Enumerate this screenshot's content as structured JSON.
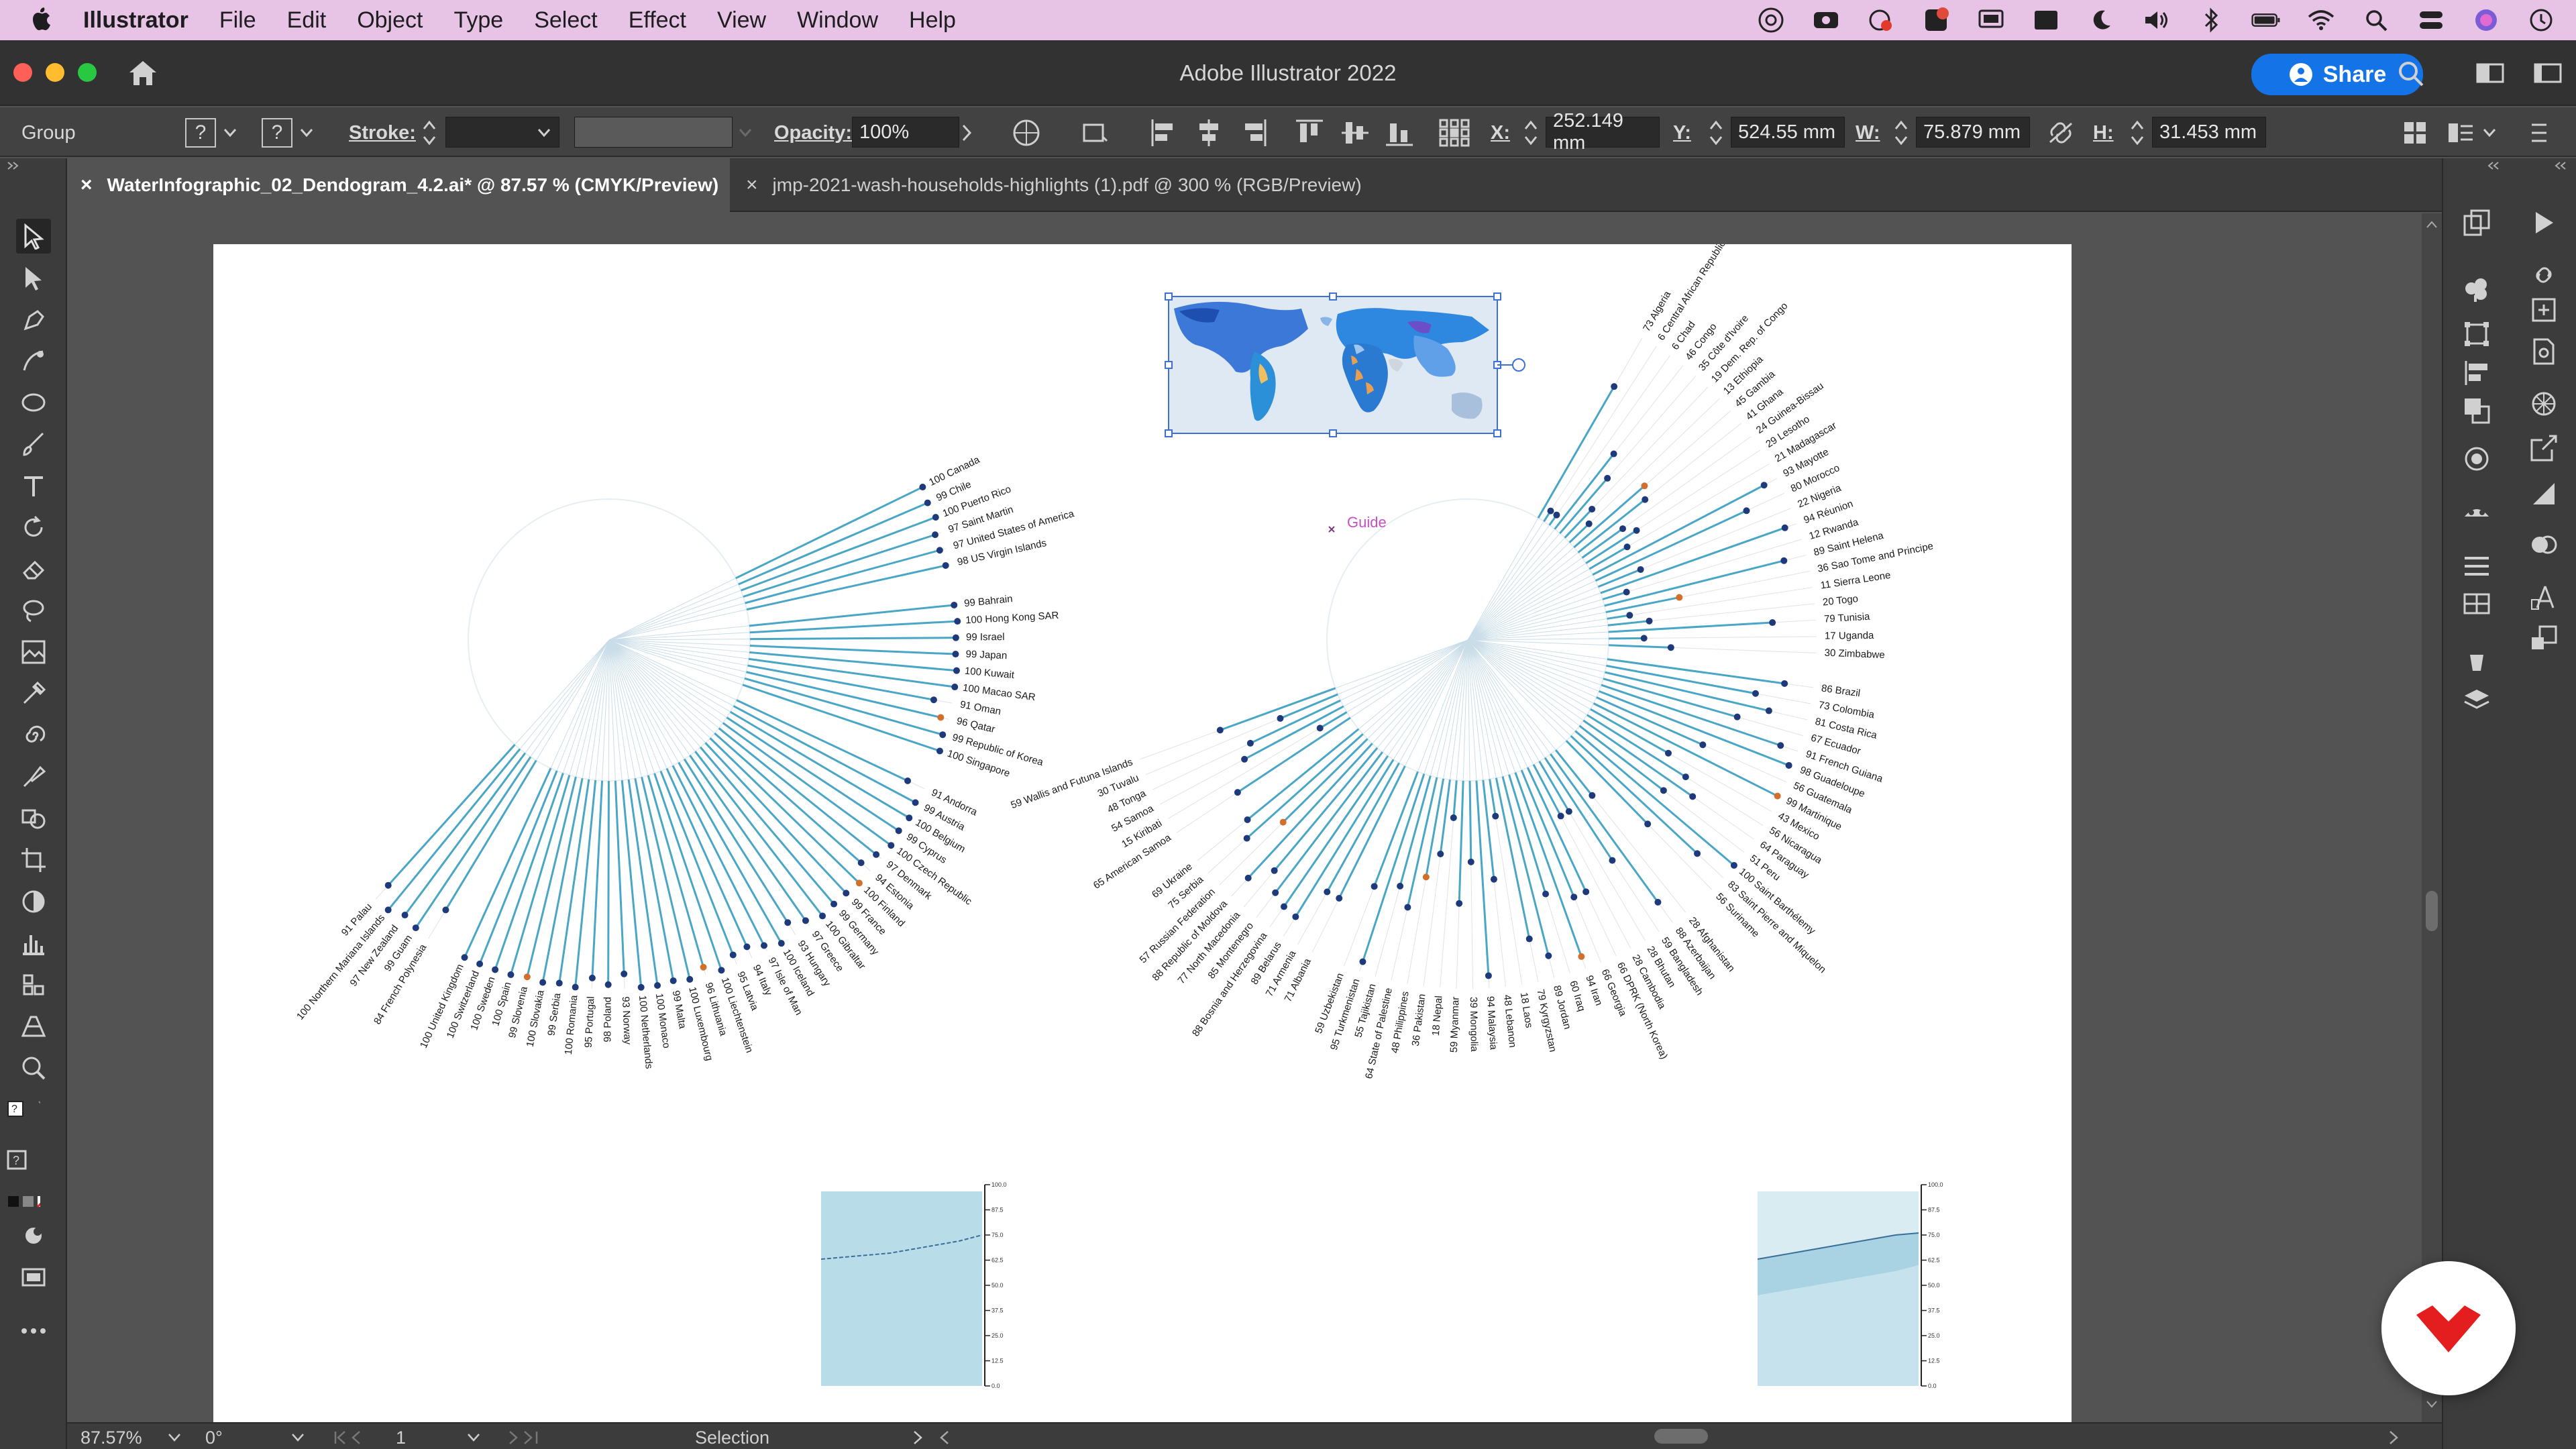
{
  "menubar": {
    "items": [
      "Illustrator",
      "File",
      "Edit",
      "Object",
      "Type",
      "Select",
      "Effect",
      "View",
      "Window",
      "Help"
    ]
  },
  "titlebar": {
    "title": "Adobe Illustrator 2022",
    "share_label": "Share"
  },
  "controlbar": {
    "selection_type": "Group",
    "stroke_label": "Stroke:",
    "opacity_label": "Opacity:",
    "opacity_value": "100%",
    "x_label": "X:",
    "x_value": "252.149 mm",
    "y_label": "Y:",
    "y_value": "524.55 mm",
    "w_label": "W:",
    "w_value": "75.879 mm",
    "h_label": "H:",
    "h_value": "31.453 mm"
  },
  "tabs": [
    {
      "label": "WaterInfographic_02_Dendogram_4.2.ai* @ 87.57 % (CMYK/Preview)",
      "active": true
    },
    {
      "label": "jmp-2021-wash-households-highlights (1).pdf @ 300 % (RGB/Preview)",
      "active": false
    }
  ],
  "canvas": {
    "guide_label": "Guide"
  },
  "statusbar": {
    "zoom": "87.57%",
    "rotation": "0°",
    "artboard": "1",
    "tool": "Selection"
  },
  "colors": {
    "menubar_bg": "#e7c3e6",
    "accent_blue": "#1473e6",
    "line_teal": "#4aa6c6",
    "dot_navy": "#1f3a7a",
    "dot_orange": "#d2702b",
    "area_light": "#b9dde8"
  },
  "left_dendrogram": {
    "group_a": [
      "100 Canada",
      "99 Chile",
      "100 Puerto Rico",
      "97 Saint Martin",
      "97 United States of America",
      "98 US Virgin Islands"
    ],
    "group_b": [
      "99 Bahrain",
      "100 Hong Kong SAR",
      "99 Israel",
      "99 Japan",
      "100 Kuwait",
      "100 Macao SAR",
      "91 Oman",
      "96 Qatar",
      "99 Republic of Korea",
      "100 Singapore"
    ],
    "group_c": [
      "91 Andorra",
      "99 Austria",
      "100 Belgium",
      "99 Cyprus",
      "100 Czech Republic",
      "97 Denmark",
      "94 Estonia",
      "100 Finland",
      "99 France",
      "99 Germany",
      "100 Gibraltar",
      "97 Greece",
      "93 Hungary",
      "100 Iceland",
      "97 Isle of Man",
      "94 Italy",
      "95 Latvia",
      "100 Liechtenstein",
      "96 Lithuania",
      "100 Luxembourg",
      "99 Malta",
      "100 Monaco",
      "100 Netherlands",
      "93 Norway",
      "98 Poland",
      "95 Portugal",
      "100 Romania",
      "99 Serbia",
      "100 Slovakia",
      "99 Slovenia",
      "100 Spain",
      "100 Sweden",
      "100 Switzerland",
      "100 United Kingdom"
    ],
    "group_d": [
      "84 French Polynesia",
      "99 Guam",
      "97 New Zealand",
      "100 Northern Mariana Islands",
      "91 Palau"
    ]
  },
  "right_dendrogram": {
    "group_a": [
      "73 Algeria",
      "6 Central African Republic",
      "6 Chad",
      "46 Congo",
      "35 Côte d'Ivoire",
      "19 Dem. Rep. of Congo",
      "13 Ethiopia",
      "45 Gambia",
      "41 Ghana",
      "24 Guinea-Bissau",
      "29 Lesotho",
      "21 Madagascar",
      "93 Mayotte",
      "80 Morocco",
      "22 Nigeria",
      "94 Réunion",
      "12 Rwanda",
      "89 Saint Helena",
      "36 Sao Tome and Principe",
      "11 Sierra Leone",
      "20 Togo",
      "79 Tunisia",
      "17 Uganda",
      "30 Zimbabwe"
    ],
    "group_b": [
      "86 Brazil",
      "73 Colombia",
      "81 Costa Rica",
      "67 Ecuador",
      "91 French Guiana",
      "98 Guadeloupe",
      "56 Guatemala",
      "99 Martinique",
      "43 Mexico",
      "56 Nicaragua",
      "64 Paraguay",
      "51 Peru",
      "100 Saint Barthélemy",
      "83 Saint Pierre and Miquelon",
      "56 Suriname"
    ],
    "group_c": [
      "28 Afghanistan",
      "88 Azerbaijan",
      "59 Bangladesh",
      "28 Bhutan",
      "28 Cambodia",
      "66 DPRK (North Korea)",
      "66 Georgia",
      "94 Iran",
      "60 Iraq",
      "89 Jordan",
      "79 Kyrgyzstan",
      "18 Laos",
      "48 Lebanon",
      "94 Malaysia",
      "39 Mongolia",
      "59 Myanmar",
      "18 Nepal",
      "36 Pakistan",
      "48 Philippines",
      "64 State of Palestine",
      "55 Tajikistan",
      "95 Turkmenistan",
      "59 Uzbekistan"
    ],
    "group_d": [
      "71 Albania",
      "71 Armenia",
      "89 Belarus",
      "88 Bosnia and Herzegovina",
      "85 Montenegro",
      "77 North Macedonia",
      "88 Republic of Moldova",
      "57 Russian Federation",
      "75 Serbia",
      "69 Ukraine"
    ],
    "group_e": [
      "65 American Samoa",
      "15 Kiribati",
      "54 Samoa",
      "48 Tonga",
      "30 Tuvalu",
      "59 Wallis and Futuna Islands"
    ]
  },
  "area_charts": {
    "left_ticks": [
      "100.0",
      "87.5",
      "75.0",
      "62.5",
      "50.0",
      "37.5",
      "25.0",
      "12.5",
      "0.0"
    ],
    "right_ticks": [
      "100.0",
      "87.5",
      "75.0",
      "62.5",
      "50.0",
      "37.5",
      "25.0",
      "12.5",
      "0.0"
    ],
    "left_line": [
      63,
      64,
      65,
      66,
      68,
      70,
      72,
      75
    ],
    "right_upper": [
      63,
      65,
      67,
      69,
      71,
      73,
      75,
      76
    ],
    "right_lower": [
      45,
      47,
      49,
      51,
      53,
      55,
      57,
      60
    ]
  }
}
